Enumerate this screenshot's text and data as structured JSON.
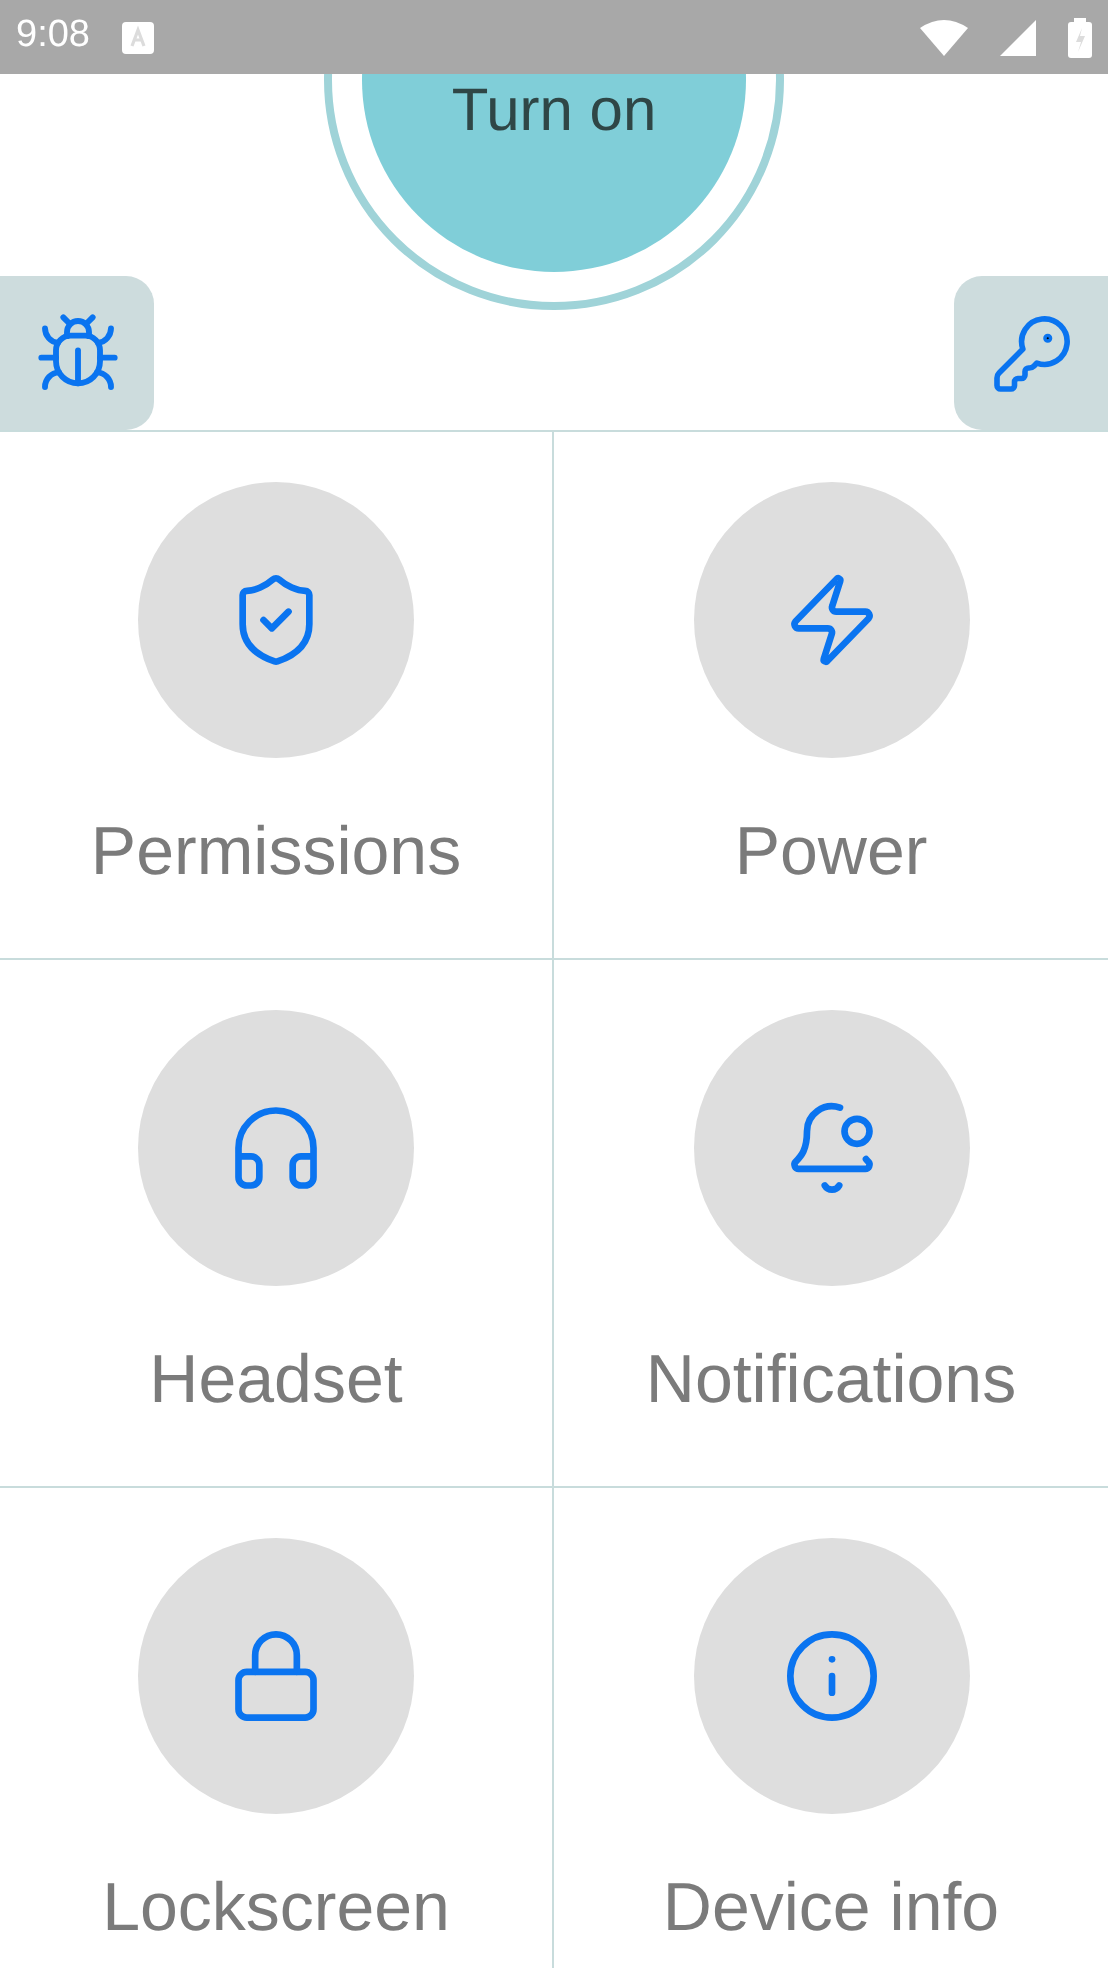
{
  "status_bar": {
    "time": "9:08"
  },
  "power_button": {
    "label": "Turn on"
  },
  "tiles": [
    {
      "label": "Permissions"
    },
    {
      "label": "Power"
    },
    {
      "label": "Headset"
    },
    {
      "label": "Notifications"
    },
    {
      "label": "Lockscreen"
    },
    {
      "label": "Device info"
    }
  ]
}
